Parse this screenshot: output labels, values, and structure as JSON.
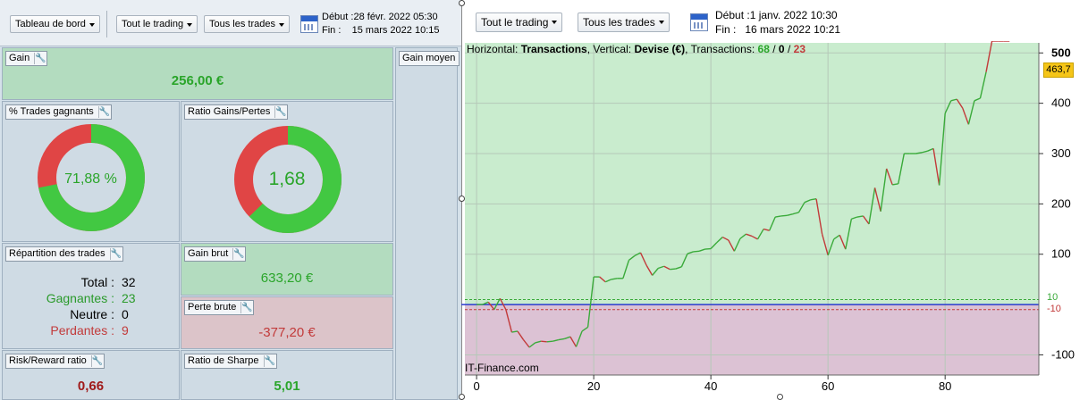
{
  "left": {
    "toolbar": {
      "dashboard": "Tableau de bord",
      "trading": "Tout le trading",
      "trades": "Tous les trades",
      "start_label": "Début :",
      "start": "28 févr. 2022 05:30",
      "end_label": "Fin :",
      "end": "15 mars 2022 10:15"
    },
    "gain": {
      "label": "Gain",
      "value": "256,00 €"
    },
    "gain_moyen": {
      "label": "Gain moyen"
    },
    "pct_gagnants": {
      "label": "% Trades gagnants",
      "value": "71,88 %",
      "fraction": 0.7188
    },
    "ratio": {
      "label": "Ratio Gains/Pertes",
      "value": "1,68",
      "fraction": 0.627
    },
    "repartition": {
      "label": "Répartition des trades",
      "total_label": "Total :",
      "total": "32",
      "gagnantes_label": "Gagnantes :",
      "gagnantes": "23",
      "neutre_label": "Neutre :",
      "neutre": "0",
      "perdantes_label": "Perdantes :",
      "perdantes": "9"
    },
    "gain_brut": {
      "label": "Gain brut",
      "value": "633,20 €"
    },
    "perte_brute": {
      "label": "Perte brute",
      "value": "-377,20 €"
    },
    "risk_reward": {
      "label": "Risk/Reward ratio",
      "value": "0,66"
    },
    "sharpe": {
      "label": "Ratio de Sharpe",
      "value": "5,01"
    }
  },
  "right": {
    "toolbar": {
      "trading": "Tout le trading",
      "trades": "Tous les trades",
      "start_label": "Début :",
      "start": "1 janv. 2022 10:30",
      "end_label": "Fin :",
      "end": "16 mars 2022 10:21"
    },
    "info": {
      "h_label": "Horizontal:",
      "h_value": "Transactions",
      "v_label": "Vertical:",
      "v_value": "Devise (€)",
      "t_label": "Transactions:",
      "wins": "68",
      "neutral": "0",
      "losses": "23",
      "sep": "/"
    },
    "watermark": "IT-Finance.com",
    "current_value": "463,7",
    "band_hi": "10",
    "band_lo": "-10"
  },
  "colors": {
    "green": "#2aa52a",
    "red": "#c23a3a",
    "panel": "#cfdbe4",
    "gain_bg": "#b3dcbf",
    "loss_bg": "#dcc4c9"
  },
  "chart_data": {
    "type": "line",
    "xlabel": "",
    "ylabel": "",
    "xlim": [
      -2,
      96
    ],
    "ylim": [
      -140,
      520
    ],
    "x_ticks": [
      0,
      20,
      40,
      60,
      80
    ],
    "y_ticks": [
      500,
      400,
      300,
      200,
      100,
      -100
    ],
    "x_ticks_labels": [
      "0",
      "20",
      "40",
      "60",
      "80"
    ],
    "y_ticks_labels": [
      "500",
      "400",
      "300",
      "200",
      "100",
      "-100"
    ],
    "band": [
      -10,
      10
    ],
    "x": [
      0,
      1,
      2,
      3,
      4,
      5,
      6,
      7,
      8,
      9,
      10,
      11,
      12,
      13,
      14,
      15,
      16,
      17,
      18,
      19,
      20,
      21,
      22,
      23,
      24,
      25,
      26,
      27,
      28,
      29,
      30,
      31,
      32,
      33,
      34,
      35,
      36,
      37,
      38,
      39,
      40,
      41,
      42,
      43,
      44,
      45,
      46,
      47,
      48,
      49,
      50,
      51,
      52,
      53,
      54,
      55,
      56,
      57,
      58,
      59,
      60,
      61,
      62,
      63,
      64,
      65,
      66,
      67,
      68,
      69,
      70,
      71,
      72,
      73,
      74,
      75,
      76,
      77,
      78,
      79,
      80,
      81,
      82,
      83,
      84,
      85,
      86,
      87,
      88,
      89,
      90,
      91
    ],
    "values": [
      0,
      0,
      5,
      -10,
      12,
      -10,
      -55,
      -53,
      -70,
      -85,
      -76,
      -73,
      -74,
      -73,
      -70,
      -68,
      -64,
      -84,
      -53,
      -45,
      55,
      55,
      45,
      50,
      52,
      52,
      88,
      97,
      103,
      78,
      58,
      72,
      76,
      70,
      71,
      75,
      101,
      105,
      106,
      110,
      111,
      123,
      134,
      128,
      106,
      131,
      140,
      136,
      130,
      150,
      147,
      174,
      176,
      177,
      180,
      183,
      203,
      208,
      210,
      140,
      98,
      130,
      138,
      110,
      170,
      174,
      176,
      160,
      232,
      185,
      270,
      238,
      240,
      300,
      300,
      300,
      302,
      305,
      310,
      237,
      380,
      405,
      408,
      390,
      358,
      405,
      410,
      462
    ],
    "series_colors": {
      "up": "#3aaa3a",
      "down": "#c23a3a"
    }
  }
}
